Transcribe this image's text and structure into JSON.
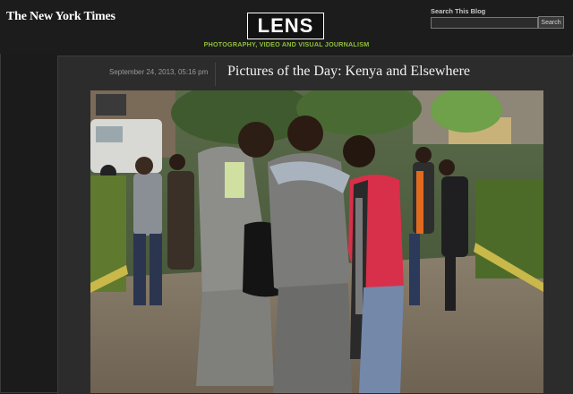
{
  "masthead": {
    "nyt_logo": "The New York Times",
    "lens_logo": "LENS",
    "tagline": "PHOTOGRAPHY, VIDEO AND VISUAL JOURNALISM"
  },
  "search": {
    "label": "Search This Blog",
    "placeholder": "",
    "button_label": "Search"
  },
  "post": {
    "date": "September 24, 2013, 05:16 pm",
    "title": "Pictures of the Day: Kenya and Elsewhere"
  },
  "colors": {
    "tagline_green": "#8fbf3a",
    "page_background": "#1b1b1b",
    "panel_background": "#2c2c2c"
  }
}
